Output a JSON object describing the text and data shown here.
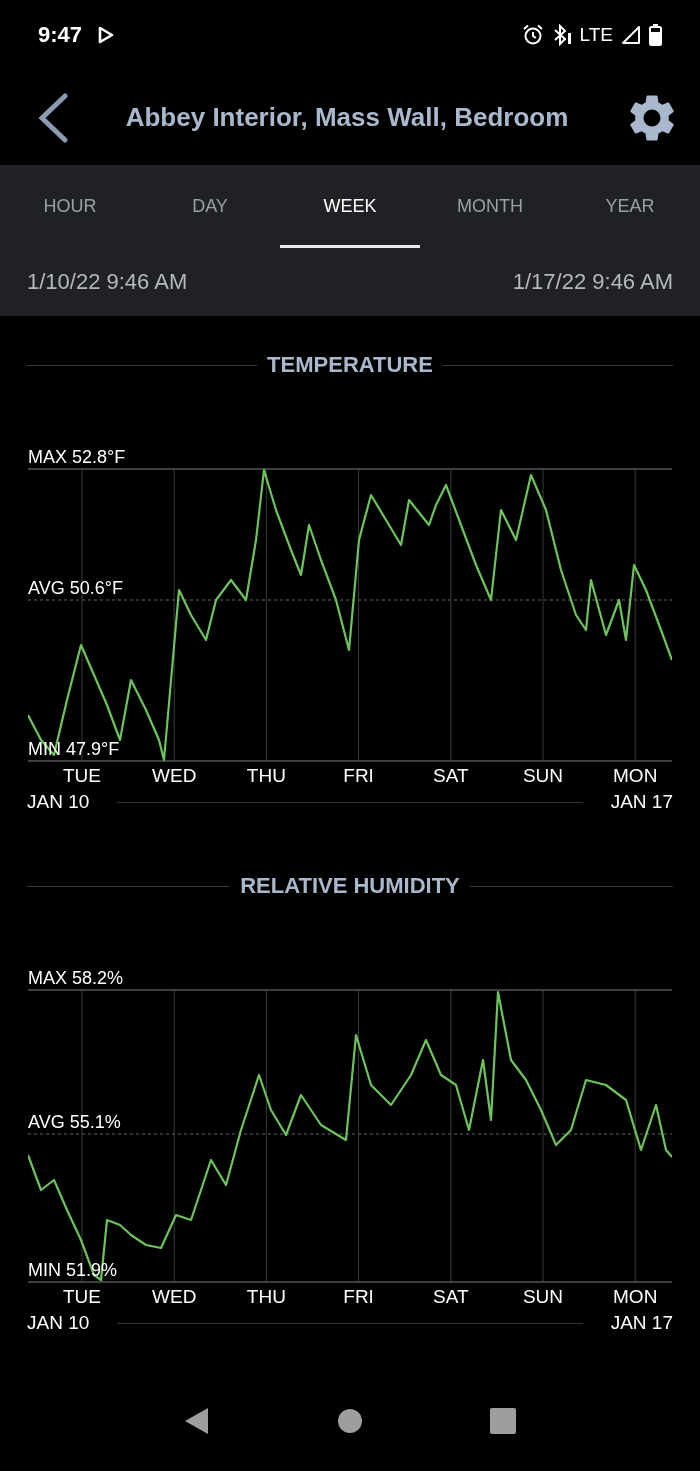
{
  "status_bar": {
    "time": "9:47",
    "network": "LTE"
  },
  "header": {
    "title": "Abbey Interior, Mass Wall, Bedroom"
  },
  "tabs": [
    {
      "label": "HOUR",
      "selected": false
    },
    {
      "label": "DAY",
      "selected": false
    },
    {
      "label": "WEEK",
      "selected": true
    },
    {
      "label": "MONTH",
      "selected": false
    },
    {
      "label": "YEAR",
      "selected": false
    }
  ],
  "range": {
    "start": "1/10/22 9:46 AM",
    "end": "1/17/22 9:46 AM"
  },
  "charts": [
    {
      "title": "TEMPERATURE",
      "max_label": "MAX 52.8°F",
      "avg_label": "AVG 50.6°F",
      "min_label": "MIN 47.9°F",
      "day_labels": [
        "TUE",
        "WED",
        "THU",
        "FRI",
        "SAT",
        "SUN",
        "MON"
      ],
      "start_label": "JAN 10",
      "end_label": "JAN 17"
    },
    {
      "title": "RELATIVE HUMIDITY",
      "max_label": "MAX 58.2%",
      "avg_label": "AVG 55.1%",
      "min_label": "MIN 51.9%",
      "day_labels": [
        "TUE",
        "WED",
        "THU",
        "FRI",
        "SAT",
        "SUN",
        "MON"
      ],
      "start_label": "JAN 10",
      "end_label": "JAN 17"
    }
  ]
}
